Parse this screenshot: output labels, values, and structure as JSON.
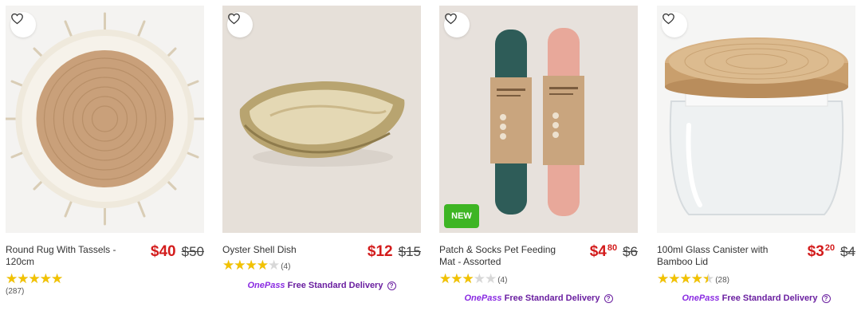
{
  "colors": {
    "price_red": "#d31c1c",
    "star_gold": "#f2c200",
    "onepass_purple": "#6a1fa0",
    "new_badge_green": "#3eb524"
  },
  "products": [
    {
      "title": "Round Rug With Tassels - 120cm",
      "price_main": "$40",
      "price_cents": "",
      "was_price": "$50",
      "rating": 5,
      "review_count": "(287)",
      "badge": "",
      "delivery": null,
      "icons": [
        "heart-icon",
        "star-icon"
      ]
    },
    {
      "title": "Oyster Shell Dish",
      "price_main": "$12",
      "price_cents": "",
      "was_price": "$15",
      "rating": 4,
      "review_count": "(4)",
      "badge": "",
      "delivery": {
        "brand": "OnePass",
        "text": "Free Standard Delivery"
      },
      "icons": [
        "heart-icon",
        "star-icon",
        "help-icon"
      ]
    },
    {
      "title": "Patch & Socks Pet Feeding Mat - Assorted",
      "price_main": "$4",
      "price_cents": "80",
      "was_price": "$6",
      "rating": 3,
      "review_count": "(4)",
      "badge": "NEW",
      "delivery": {
        "brand": "OnePass",
        "text": "Free Standard Delivery"
      },
      "icons": [
        "heart-icon",
        "star-icon",
        "help-icon"
      ]
    },
    {
      "title": "100ml Glass Canister with Bamboo Lid",
      "price_main": "$3",
      "price_cents": "20",
      "was_price": "$4",
      "rating": 4.5,
      "review_count": "(28)",
      "badge": "",
      "delivery": {
        "brand": "OnePass",
        "text": "Free Standard Delivery"
      },
      "icons": [
        "heart-icon",
        "star-icon",
        "help-icon"
      ]
    }
  ]
}
